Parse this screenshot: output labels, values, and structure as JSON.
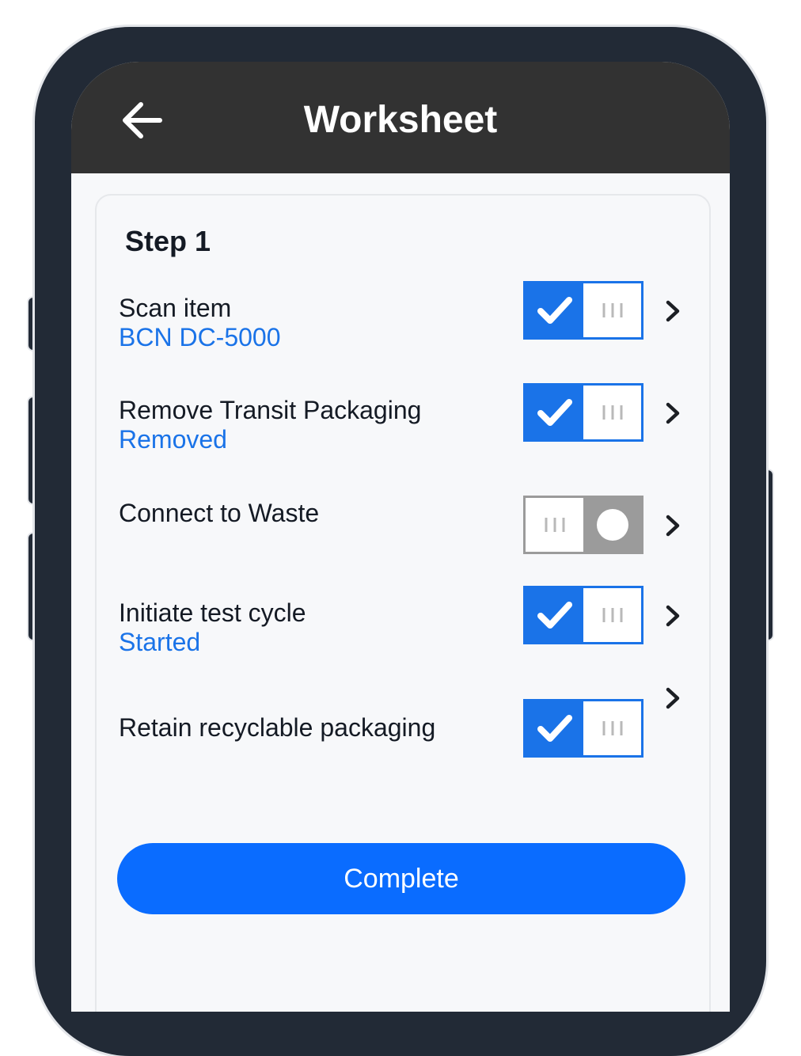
{
  "header": {
    "title": "Worksheet",
    "back_icon": "arrow-left-icon"
  },
  "step": {
    "title": "Step 1"
  },
  "tasks": [
    {
      "label": "Scan item",
      "status": "BCN DC-5000",
      "checked": true
    },
    {
      "label": "Remove Transit Packaging",
      "status": "Removed",
      "checked": true
    },
    {
      "label": "Connect to Waste",
      "status": "",
      "checked": false
    },
    {
      "label": "Initiate test cycle",
      "status": "Started",
      "checked": true
    },
    {
      "label": "Retain recyclable packaging",
      "status": "",
      "checked": true
    }
  ],
  "actions": {
    "complete_label": "Complete"
  },
  "colors": {
    "accent": "#1a73e8",
    "button": "#0a6cff",
    "appbar": "#323232",
    "frame": "#222a36",
    "toggle_off": "#9b9b9b"
  }
}
